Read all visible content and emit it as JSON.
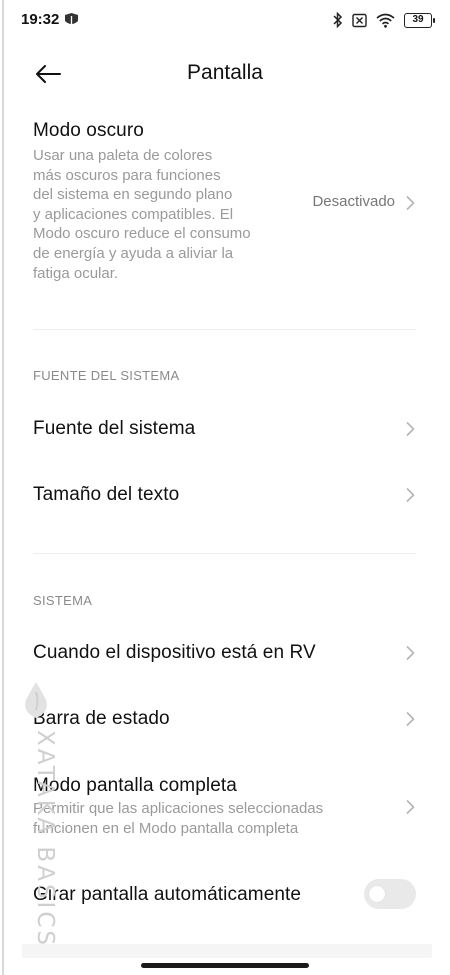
{
  "status_bar": {
    "time": "19:32",
    "battery": "39",
    "left_icon": "app-notification-icon",
    "icons": [
      "bluetooth-icon",
      "no-sim-icon",
      "wifi-icon",
      "battery-icon"
    ]
  },
  "header": {
    "title": "Pantalla",
    "back_icon": "back-arrow-icon"
  },
  "dark_mode": {
    "title": "Modo oscuro",
    "description": "Usar una paleta de colores más oscuros para funciones del sistema en segundo plano y aplicaciones compatibles. El Modo oscuro reduce el consumo de energía y ayuda a aliviar la fatiga ocular.",
    "desc_lines": [
      "Usar una paleta de colores",
      "más oscuros para funciones",
      "del sistema en segundo plano",
      "y aplicaciones compatibles. El",
      "Modo oscuro reduce el consumo",
      "de energía y ayuda a aliviar la",
      "fatiga ocular."
    ],
    "value": "Desactivado"
  },
  "font_section": {
    "header": "FUENTE DEL SISTEMA",
    "items": [
      {
        "label": "Fuente del sistema"
      },
      {
        "label": "Tamaño del texto"
      }
    ]
  },
  "system_section": {
    "header": "SISTEMA",
    "items": [
      {
        "label": "Cuando el dispositivo está en RV"
      },
      {
        "label": "Barra de estado"
      },
      {
        "label": "Modo pantalla completa",
        "desc_lines": [
          "Permitir que las aplicaciones seleccionadas",
          "funcionen en el Modo pantalla completa"
        ]
      },
      {
        "label": "Girar pantalla automáticamente",
        "toggle": false
      }
    ]
  },
  "watermark": {
    "text": "XATAKA BASICS"
  },
  "colors": {
    "text_primary": "#111111",
    "text_secondary": "#9a9a9a",
    "section_header": "#8a8a8a",
    "divider": "#ececec",
    "toggle_off": "#e9e9e9"
  }
}
